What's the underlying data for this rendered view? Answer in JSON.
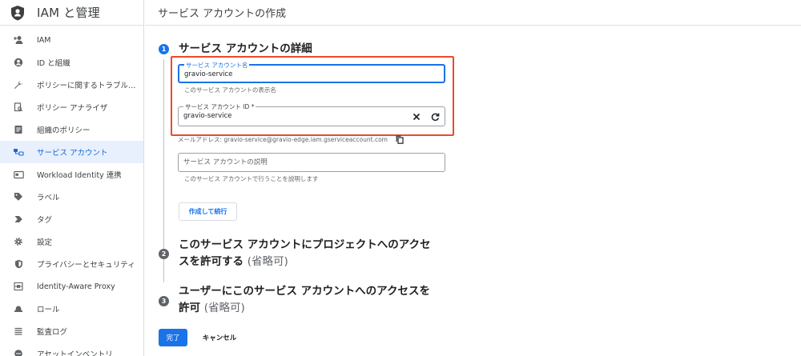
{
  "sidebar": {
    "title": "IAM と管理",
    "items": [
      {
        "label": "IAM",
        "icon": "person-add-icon",
        "active": false
      },
      {
        "label": "ID と組織",
        "icon": "account-circle-icon",
        "active": false
      },
      {
        "label": "ポリシーに関するトラブル…",
        "icon": "wrench-icon",
        "active": false
      },
      {
        "label": "ポリシー アナライザ",
        "icon": "document-search-icon",
        "active": false
      },
      {
        "label": "組織のポリシー",
        "icon": "list-document-icon",
        "active": false
      },
      {
        "label": "サービス アカウント",
        "icon": "service-account-icon",
        "active": true
      },
      {
        "label": "Workload Identity 連携",
        "icon": "id-card-icon",
        "active": false
      },
      {
        "label": "ラベル",
        "icon": "label-tag-icon",
        "active": false
      },
      {
        "label": "タグ",
        "icon": "tag-arrow-icon",
        "active": false
      },
      {
        "label": "設定",
        "icon": "gear-icon",
        "active": false
      },
      {
        "label": "プライバシーとセキュリティ",
        "icon": "shield-icon",
        "active": false
      },
      {
        "label": "Identity-Aware Proxy",
        "icon": "proxy-icon",
        "active": false
      },
      {
        "label": "ロール",
        "icon": "hat-icon",
        "active": false
      },
      {
        "label": "監査ログ",
        "icon": "list-lines-icon",
        "active": false
      },
      {
        "label": "アセットインベントリ",
        "icon": "inventory-icon",
        "active": false
      }
    ]
  },
  "header": {
    "title": "サービス アカウントの作成"
  },
  "steps": [
    {
      "number": "1",
      "title": "サービス アカウントの詳細",
      "optional": ""
    },
    {
      "number": "2",
      "title_line1": "このサービス アカウントにプロジェクトへのアクセ",
      "title_line2": "スを許可する",
      "optional": "(省略可)"
    },
    {
      "number": "3",
      "title_line1": "ユーザーにこのサービス アカウントへのアクセスを",
      "title_line2": "許可",
      "optional": "(省略可)"
    }
  ],
  "form": {
    "name_label": "サービス アカウント名",
    "name_value": "gravio-service",
    "name_hint": "このサービス アカウントの表示名",
    "id_label": "サービス アカウント ID *",
    "id_value": "gravio-service",
    "email_text": "メールアドレス: gravio-service@gravio-edge.iam.gserviceaccount.com",
    "description_placeholder": "サービス アカウントの説明",
    "description_hint": "このサービス アカウントで行うことを説明します",
    "create_continue_label": "作成して続行"
  },
  "footer": {
    "done_label": "完了",
    "cancel_label": "キャンセル"
  },
  "colors": {
    "accent": "#1a73e8",
    "highlight": "#ea4b2a",
    "active_bg": "#e8f0fe"
  }
}
